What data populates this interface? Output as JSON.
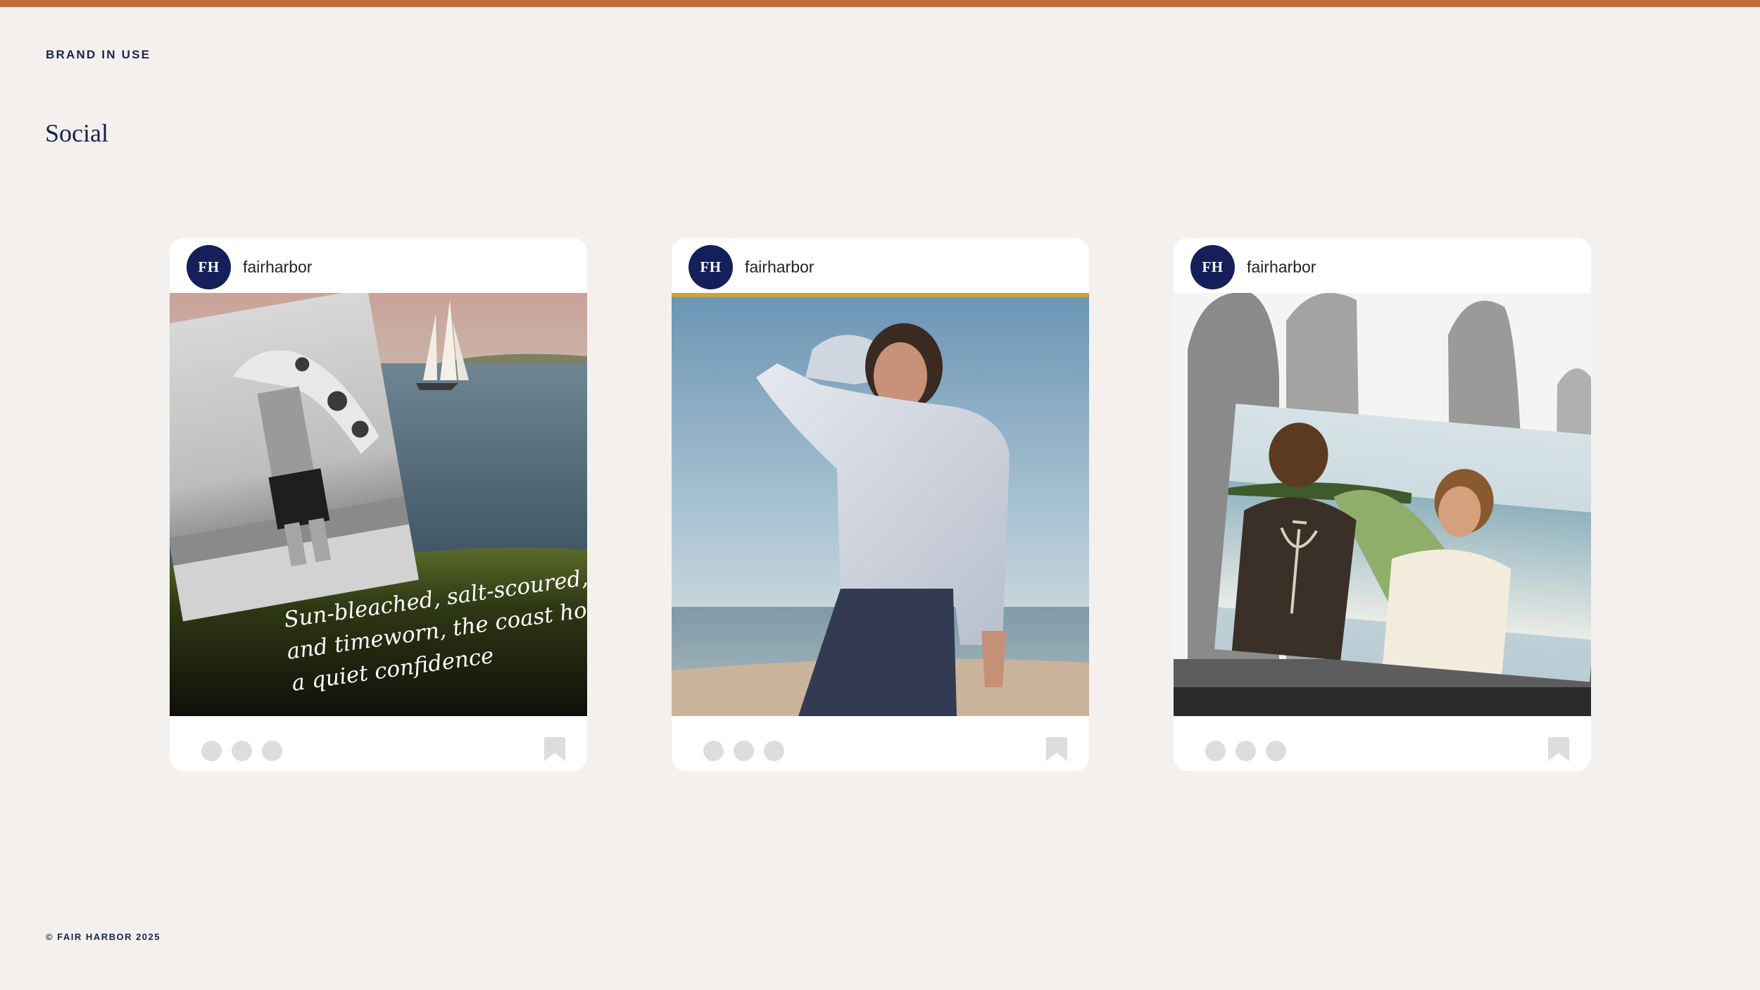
{
  "header": {
    "eyebrow": "BRAND IN USE",
    "title": "Social"
  },
  "footer": {
    "copyright": "© FAIR HARBOR 2025"
  },
  "colors": {
    "accent_bar": "#c06d35",
    "navy": "#15205a",
    "background": "#f3f0ed"
  },
  "posts": [
    {
      "avatar_text": "FH",
      "username": "fairharbor",
      "caption_lines": [
        "Sun-bleached, salt-scoured,",
        "and timeworn, the coast holds",
        "a quiet confidence"
      ],
      "actions": [
        "heart-icon",
        "comment-icon",
        "share-icon"
      ],
      "save_icon": "bookmark-icon"
    },
    {
      "avatar_text": "FH",
      "username": "fairharbor",
      "actions": [
        "heart-icon",
        "comment-icon",
        "share-icon"
      ],
      "save_icon": "bookmark-icon"
    },
    {
      "avatar_text": "FH",
      "username": "fairharbor",
      "actions": [
        "heart-icon",
        "comment-icon",
        "share-icon"
      ],
      "save_icon": "bookmark-icon"
    }
  ]
}
